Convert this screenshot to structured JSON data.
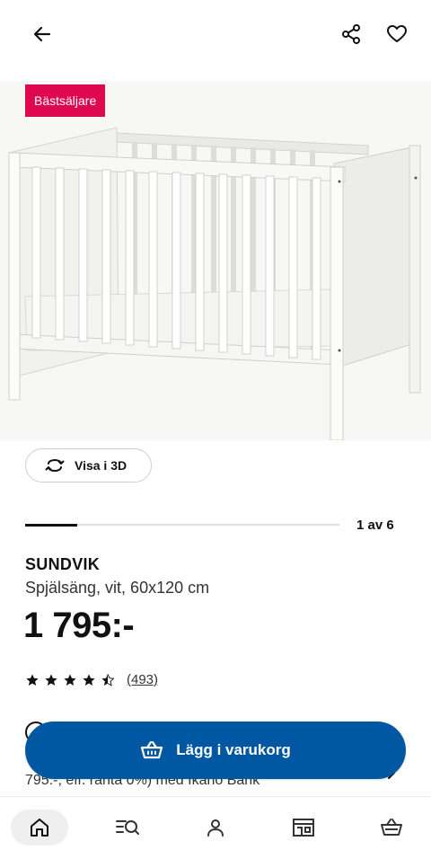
{
  "header": {
    "back_icon": "arrow-left-icon",
    "share_icon": "share-icon",
    "favourite_icon": "heart-icon"
  },
  "badge": {
    "label": "Bästsäljare",
    "color": "#e00751"
  },
  "view3d": {
    "label": "Visa i 3D",
    "icon": "rotate-3d-icon"
  },
  "gallery": {
    "current": 1,
    "total": 6,
    "pager_label": "1 av 6"
  },
  "product": {
    "name": "SUNDVIK",
    "description": "Spjälsäng, vit, 60x120 cm",
    "price": "1 795:-"
  },
  "rating": {
    "stars": 4.5,
    "max": 5,
    "review_count": "(493)"
  },
  "finance": {
    "text": "795:-, eff. ränta 0%) med Ikano Bank"
  },
  "cart_button": {
    "label": "Lägg i varukorg",
    "icon": "basket-icon",
    "color": "#0058a3"
  },
  "bottom_nav": {
    "items": [
      {
        "icon": "home-icon",
        "active": true
      },
      {
        "icon": "search-list-icon",
        "active": false
      },
      {
        "icon": "person-icon",
        "active": false
      },
      {
        "icon": "store-icon",
        "active": false
      },
      {
        "icon": "basket-icon",
        "active": false
      }
    ]
  }
}
